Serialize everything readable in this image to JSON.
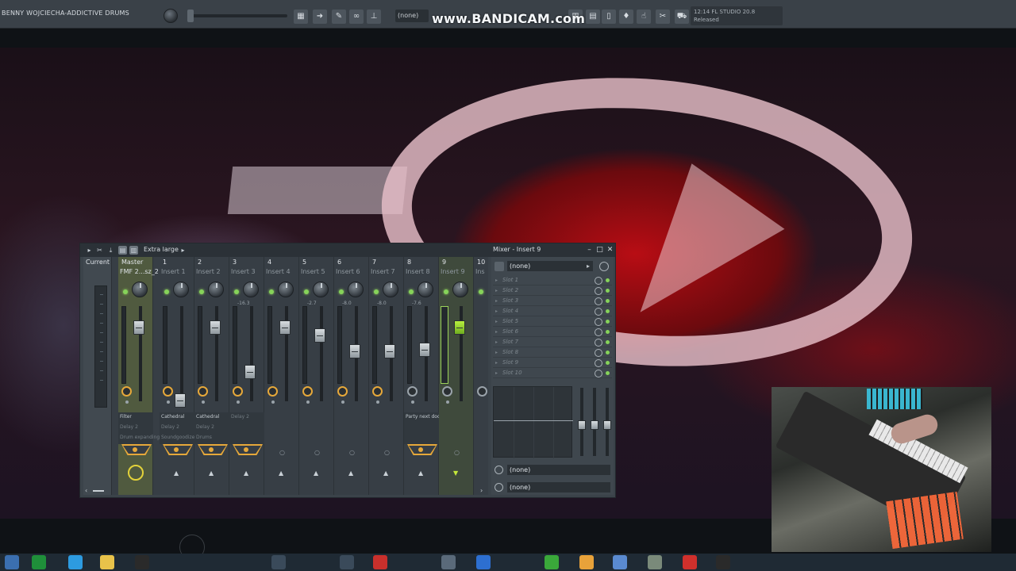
{
  "topbar": {
    "song_title": "BENNY WOJCIECHA-ADDICTIVE DRUMS",
    "pattern_select": "(none)",
    "watermark": "www.BANDICAM.com",
    "hint_line1": "12:14  FL STUDIO 20.8",
    "hint_line2": "Released"
  },
  "mixer": {
    "size_label": "Extra large",
    "current_label": "Current",
    "strips": [
      {
        "num": "Master",
        "name": "FMF 2...sz_2",
        "db": "",
        "slot1": "Filter",
        "slot2": "",
        "slot3": "",
        "route": "on"
      },
      {
        "num": "1",
        "name": "Insert 1",
        "db": "",
        "slot1": "Cathedral",
        "slot2": "Delay 2",
        "slot3": "Soundgoodizer",
        "route": "on"
      },
      {
        "num": "2",
        "name": "Insert 2",
        "db": "",
        "slot1": "Cathedral",
        "slot2": "Delay 2",
        "slot3": "Drums",
        "route": "on"
      },
      {
        "num": "3",
        "name": "Insert 3",
        "db": "-16.3",
        "slot1": "Delay 2",
        "slot2": "",
        "slot3": "",
        "route": "on"
      },
      {
        "num": "4",
        "name": "Insert 4",
        "db": "",
        "slot1": "",
        "slot2": "",
        "slot3": "",
        "route": "on"
      },
      {
        "num": "5",
        "name": "Insert 5",
        "db": "-2.7",
        "slot1": "",
        "slot2": "",
        "slot3": "",
        "route": "on"
      },
      {
        "num": "6",
        "name": "Insert 6",
        "db": "-8.0",
        "slot1": "",
        "slot2": "",
        "slot3": "",
        "route": "on"
      },
      {
        "num": "7",
        "name": "Insert 7",
        "db": "-8.0",
        "slot1": "",
        "slot2": "",
        "slot3": "",
        "route": "on"
      },
      {
        "num": "8",
        "name": "Insert 8",
        "db": "-7.6",
        "slot1": "Party next door",
        "slot2": "",
        "slot3": "",
        "route": "off"
      },
      {
        "num": "9",
        "name": "Insert 9",
        "db": "",
        "slot1": "",
        "slot2": "",
        "slot3": "",
        "route": "off"
      },
      {
        "num": "10",
        "name": "Ins",
        "db": "",
        "slot1": "",
        "slot2": "",
        "slot3": "",
        "route": "off"
      }
    ],
    "master_slots": [
      "Delay 2",
      "Drum expanding"
    ]
  },
  "insert_panel": {
    "caption": "Mixer - Insert 9",
    "preset": "(none)",
    "slots": [
      "Slot 1",
      "Slot 2",
      "Slot 3",
      "Slot 4",
      "Slot 5",
      "Slot 6",
      "Slot 7",
      "Slot 8",
      "Slot 9",
      "Slot 10"
    ],
    "input_select": "(none)",
    "output_select": "(none)"
  }
}
